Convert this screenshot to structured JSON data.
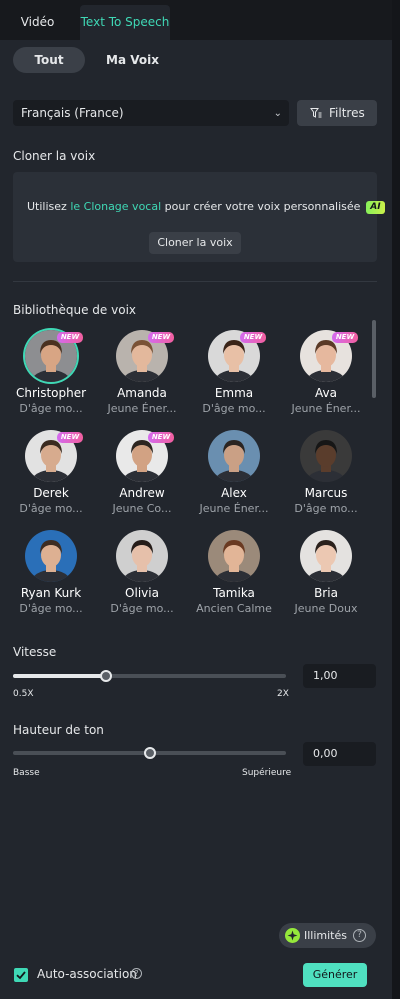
{
  "tabs": [
    {
      "label": "Vidéo",
      "active": false
    },
    {
      "label": "Text To Speech",
      "active": true
    }
  ],
  "filters": {
    "all_label": "Tout",
    "my_voice_label": "Ma Voix",
    "language_value": "Français (France)",
    "filters_label": "Filtres"
  },
  "clone": {
    "title": "Cloner la voix",
    "text_before": "Utilisez ",
    "link_text": "le Clonage vocal",
    "text_after": " pour créer votre voix personnalisée",
    "ai_badge": "AI",
    "button_label": "Cloner la voix"
  },
  "library": {
    "title": "Bibliothèque de voix",
    "new_badge": "NEW",
    "voices": [
      {
        "name": "Christopher",
        "desc": "D'âge mo...",
        "new": true,
        "selected": true,
        "skin": "#d8a584",
        "hair": "#4a3120",
        "bg": "#8d8e91"
      },
      {
        "name": "Amanda",
        "desc": "Jeune Éner...",
        "new": true,
        "selected": false,
        "skin": "#e3b89c",
        "hair": "#7a5236",
        "bg": "#b9b3ad"
      },
      {
        "name": "Emma",
        "desc": "D'âge mo...",
        "new": true,
        "selected": false,
        "skin": "#e8c0a6",
        "hair": "#3a2418",
        "bg": "#d9d9d9"
      },
      {
        "name": "Ava",
        "desc": "Jeune Éner...",
        "new": true,
        "selected": false,
        "skin": "#e6b89e",
        "hair": "#5b3a26",
        "bg": "#e7e2de"
      },
      {
        "name": "Derek",
        "desc": "D'âge mo...",
        "new": true,
        "selected": false,
        "skin": "#d7ab8e",
        "hair": "#3b2b20",
        "bg": "#e2e2e2"
      },
      {
        "name": "Andrew",
        "desc": "Jeune Co...",
        "new": true,
        "selected": false,
        "skin": "#d2a283",
        "hair": "#2d2520",
        "bg": "#e9e9e9"
      },
      {
        "name": "Alex",
        "desc": "Jeune Éner...",
        "new": false,
        "selected": false,
        "skin": "#caa085",
        "hair": "#2b2522",
        "bg": "#6a8fb0"
      },
      {
        "name": "Marcus",
        "desc": "D'âge mo...",
        "new": false,
        "selected": false,
        "skin": "#5a3d2c",
        "hair": "#161616",
        "bg": "#3a3a3a"
      },
      {
        "name": "Ryan Kurk",
        "desc": "D'âge mo...",
        "new": false,
        "selected": false,
        "skin": "#ddb092",
        "hair": "#3e2d22",
        "bg": "#2a6fb8"
      },
      {
        "name": "Olivia",
        "desc": "D'âge mo...",
        "new": false,
        "selected": false,
        "skin": "#e6c0aa",
        "hair": "#251c18",
        "bg": "#cfcfcf"
      },
      {
        "name": "Tamika",
        "desc": "Ancien Calme",
        "new": false,
        "selected": false,
        "skin": "#e2b597",
        "hair": "#6a3a22",
        "bg": "#9b8a7a"
      },
      {
        "name": "Bria",
        "desc": "Jeune Doux",
        "new": false,
        "selected": false,
        "skin": "#ecc8b2",
        "hair": "#2a211c",
        "bg": "#e4e2e0"
      }
    ]
  },
  "speed": {
    "title": "Vitesse",
    "value": "1,00",
    "level": 0.34,
    "min_label": "0.5X",
    "max_label": "2X"
  },
  "pitch": {
    "title": "Hauteur de ton",
    "value": "0,00",
    "level": 0.5,
    "min_label": "Basse",
    "max_label": "Supérieure"
  },
  "footer": {
    "unlimited_label": "Illimités",
    "help_mark": "?",
    "auto_match_label": "Auto-association",
    "generate_label": "Générer"
  },
  "colors": {
    "accent": "#3fd8b5",
    "panel_bg": "#22262d",
    "generate_bg": "#4fe0c0"
  }
}
